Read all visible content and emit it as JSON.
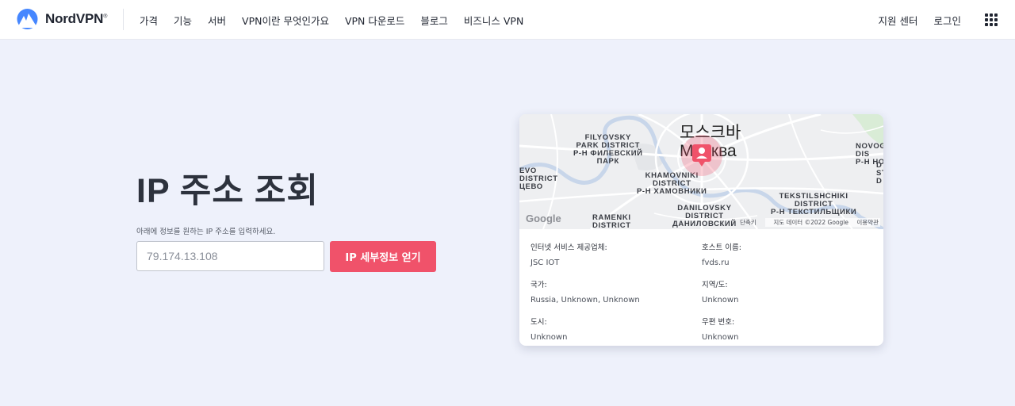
{
  "brand": {
    "name": "NordVPN",
    "mark": "®",
    "accent": "#4687ff"
  },
  "nav": {
    "items": [
      "가격",
      "기능",
      "서버",
      "VPN이란 무엇인가요",
      "VPN 다운로드",
      "블로그",
      "비즈니스 VPN"
    ],
    "support": "지원 센터",
    "login": "로그인",
    "apps_icon": "grid-icon"
  },
  "main": {
    "title": "IP 주소 조회",
    "hint": "아래에 정보를 원하는 IP 주소를 입력하세요.",
    "input_placeholder": "79.174.13.108",
    "input_value": "",
    "button_label": "IP 세부정보 얻기",
    "button_color": "#f0526a"
  },
  "map": {
    "city_ko": "모스크바",
    "city_ru": "Москва",
    "labels": {
      "filyovsky": "FILYOVSKY\nPARK DISTRICT\nР-Н ФИЛЕВСКИЙ\nПАРК",
      "novog": "NOVOG\nDIS\nР-Н НОВ",
      "evo": "EVO\nDISTRICT\nЦЕВО",
      "khamovniki": "KHAMOVNIKI\nDISTRICT\nР-Н ХАМОВНИКИ",
      "tekstilshchiki": "TEKSTILSHCHIKI\nDISTRICT\nР-Н ТЕКСТИЛЬЩИКИ",
      "danilovsky": "DANILOVSKY\nDISTRICT\nДАНИЛОВСКИЙ",
      "ramenki": "RAMENKI\nDISTRICT",
      "right_edge": "D\nST\nD"
    },
    "google": "Google",
    "shortcuts": "단축키",
    "attribution": "지도 데이터 ©2022 Google",
    "scale": "",
    "terms": "이용약관"
  },
  "details": [
    {
      "label": "인터넷 서비스 제공업체:",
      "value": "JSC IOT"
    },
    {
      "label": "호스트 이름:",
      "value": "fvds.ru"
    },
    {
      "label": "국가:",
      "value": "Russia, Unknown, Unknown"
    },
    {
      "label": "지역/도:",
      "value": "Unknown"
    },
    {
      "label": "도시:",
      "value": "Unknown"
    },
    {
      "label": "우편 번호:",
      "value": "Unknown"
    }
  ]
}
